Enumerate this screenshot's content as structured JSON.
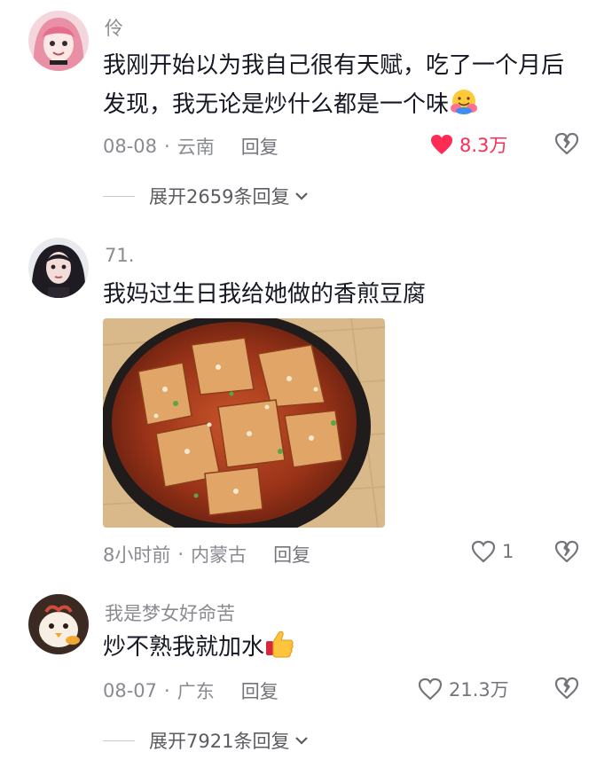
{
  "comments": [
    {
      "username": "伶",
      "text": "我刚开始以为我自己很有天赋，吃了一个月后发现，我无论是炒什么都是一个味",
      "emoji": "hugging-face-emoji",
      "date": "08-08",
      "location": "云南",
      "reply_label": "回复",
      "likes": "8.3万",
      "liked": true,
      "expand_label": "展开2659条回复"
    },
    {
      "username": "71.",
      "text": "我妈过生日我给她做的香煎豆腐",
      "image": "pan-fried-tofu-photo",
      "date": "8小时前",
      "location": "内蒙古",
      "reply_label": "回复",
      "likes": "1",
      "liked": false
    },
    {
      "username": "我是梦女好命苦",
      "text": "炒不熟我就加水",
      "emoji": "thumbs-up-emoji",
      "date": "08-07",
      "location": "广东",
      "reply_label": "回复",
      "likes": "21.3万",
      "liked": false,
      "expand_label": "展开7921条回复"
    }
  ],
  "separator": "·",
  "colors": {
    "liked": "#fe2c55",
    "muted": "#8a8b91",
    "text": "#161823"
  }
}
